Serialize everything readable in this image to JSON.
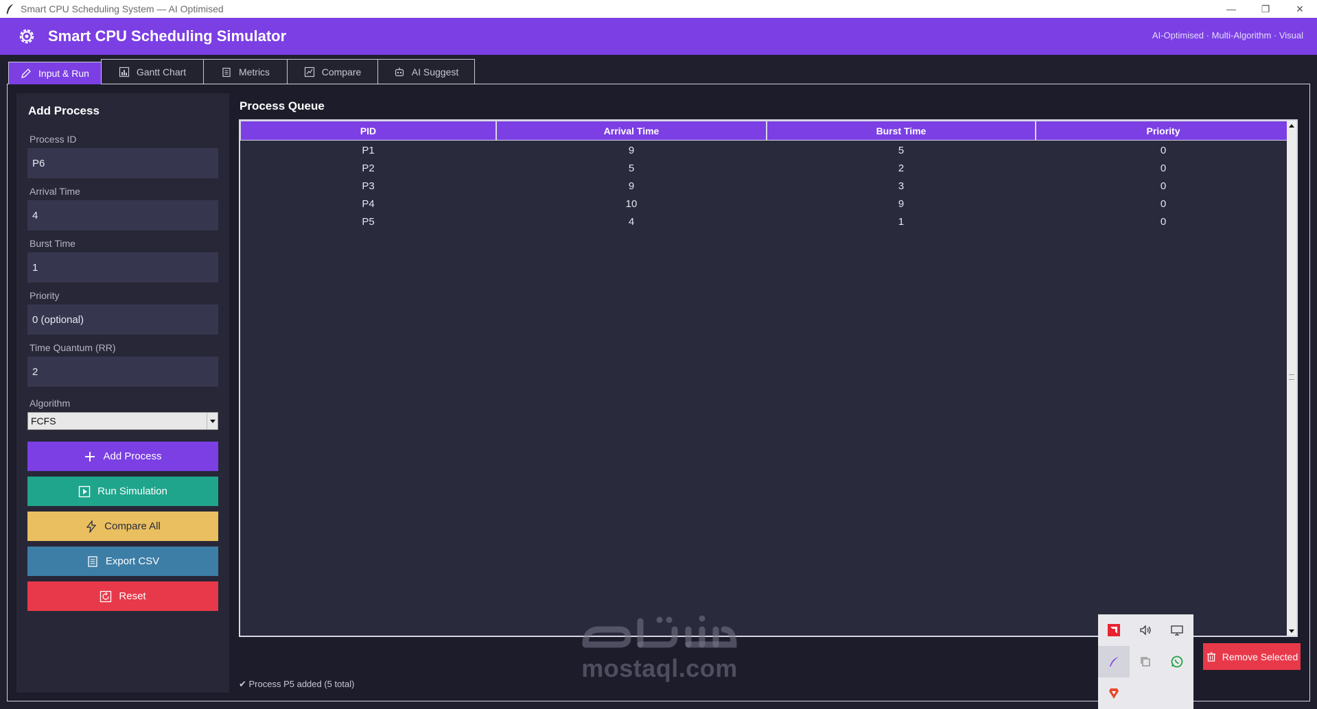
{
  "window": {
    "title": "Smart CPU Scheduling System — AI Optimised",
    "controls": [
      "—",
      "❐",
      "✕"
    ]
  },
  "header": {
    "title": "Smart CPU Scheduling Simulator",
    "tagline": "AI-Optimised · Multi-Algorithm · Visual",
    "accent_color": "#7b3fe4"
  },
  "tabs": [
    {
      "label": "Input & Run",
      "icon": "pencil-icon",
      "active": true
    },
    {
      "label": "Gantt Chart",
      "icon": "bar-chart-icon",
      "active": false
    },
    {
      "label": "Metrics",
      "icon": "clipboard-icon",
      "active": false
    },
    {
      "label": "Compare",
      "icon": "compare-icon",
      "active": false
    },
    {
      "label": "AI Suggest",
      "icon": "robot-icon",
      "active": false
    }
  ],
  "form": {
    "title": "Add Process",
    "process_id": {
      "label": "Process ID",
      "value": "P6"
    },
    "arrival_time": {
      "label": "Arrival Time",
      "value": "4"
    },
    "burst_time": {
      "label": "Burst Time",
      "value": "1"
    },
    "priority": {
      "label": "Priority",
      "value": "0  (optional)"
    },
    "time_quantum": {
      "label": "Time Quantum (RR)",
      "value": "2"
    },
    "algorithm": {
      "label": "Algorithm",
      "value": "FCFS"
    }
  },
  "buttons": {
    "add": {
      "label": "Add Process",
      "color": "#7b3fe4"
    },
    "run": {
      "label": "Run Simulation",
      "color": "#1fa58c"
    },
    "compare": {
      "label": "Compare All",
      "color": "#e9bf5f"
    },
    "export": {
      "label": "Export CSV",
      "color": "#3d7ea6"
    },
    "reset": {
      "label": "Reset",
      "color": "#e8394a"
    },
    "remove": {
      "label": "Remove Selected",
      "color": "#e8394a"
    }
  },
  "queue": {
    "title": "Process Queue",
    "columns": [
      "PID",
      "Arrival Time",
      "Burst Time",
      "Priority"
    ],
    "rows": [
      [
        "P1",
        "9",
        "5",
        "0"
      ],
      [
        "P2",
        "5",
        "2",
        "0"
      ],
      [
        "P3",
        "9",
        "3",
        "0"
      ],
      [
        "P4",
        "10",
        "9",
        "0"
      ],
      [
        "P5",
        "4",
        "1",
        "0"
      ]
    ]
  },
  "status": {
    "text": "✔  Process P5 added  (5 total)"
  },
  "watermark": {
    "latin": "mostaql.com"
  }
}
